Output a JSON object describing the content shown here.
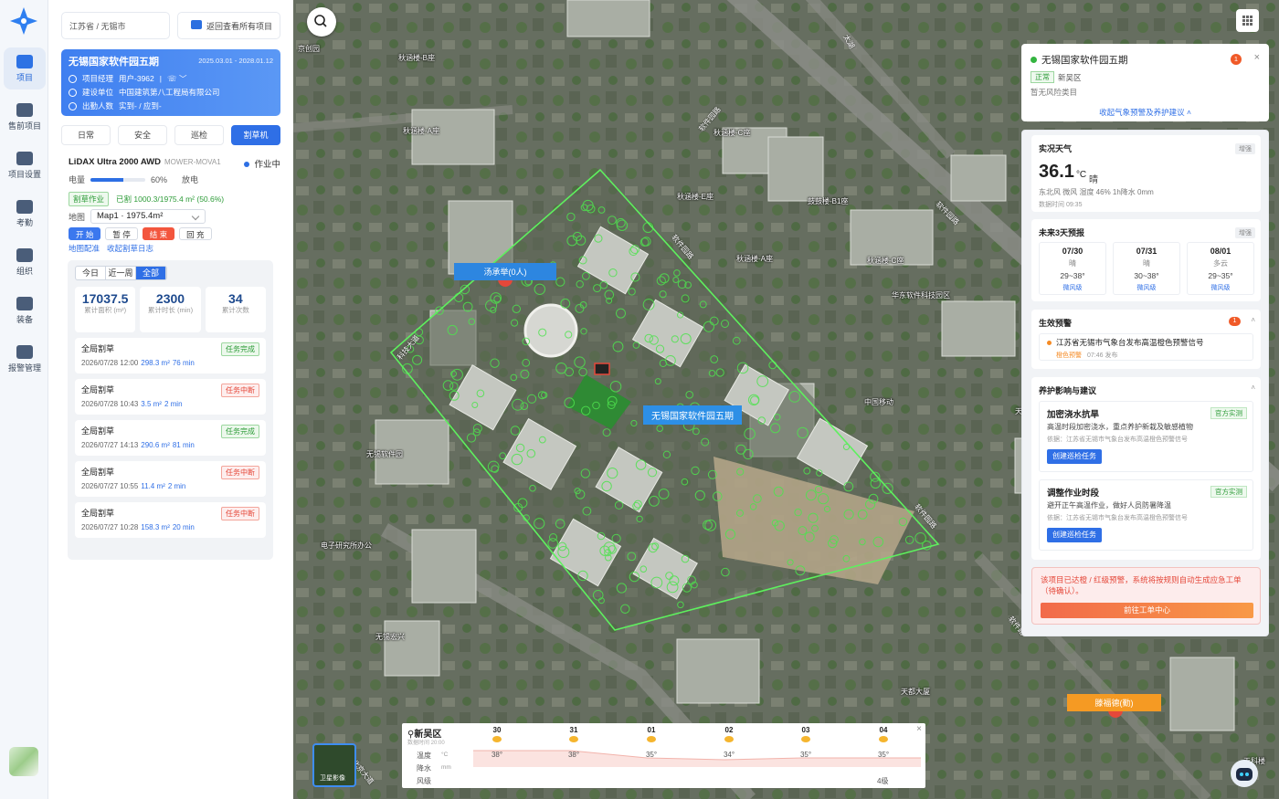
{
  "nav": {
    "items": [
      {
        "label": "项目"
      },
      {
        "label": "售前项目"
      },
      {
        "label": "项目设置"
      },
      {
        "label": "考勤"
      },
      {
        "label": "组织"
      },
      {
        "label": "装备"
      },
      {
        "label": "报警管理"
      }
    ]
  },
  "left": {
    "location": "江苏省 / 无锡市",
    "back_label": "返回查看所有项目",
    "project": {
      "name": "无锡国家软件园五期",
      "dates": "2025.03.01 - 2028.01.12",
      "manager_label": "项目经理",
      "manager": "用户-3962",
      "builder_label": "建设单位",
      "builder": "中国建筑第八工程局有限公司",
      "attend_label": "出勤人数",
      "attend": "实到- / 应到-"
    },
    "tabs": [
      "日常",
      "安全",
      "巡检",
      "割草机"
    ],
    "device": {
      "name": "LiDAX Ultra 2000 AWD",
      "model": "MOWER-MOVA1",
      "status": "作业中",
      "battery_label": "电量",
      "battery_pct": 60,
      "battery_text": "60%",
      "discharge": "放电",
      "mode_tag": "割草作业",
      "done": "已割 1000.3/1975.4 m² (50.6%)",
      "map_label": "地图",
      "map_value": "Map1 · 1975.4m²",
      "buttons": [
        "开 始",
        "暂 停",
        "结 束",
        "回 充"
      ],
      "links": [
        "地图配准",
        "收起割草日志"
      ]
    },
    "range": [
      "今日",
      "近一周",
      "全部"
    ],
    "totals": [
      {
        "value": "17037.5",
        "label": "累计面积 (m²)"
      },
      {
        "value": "2300",
        "label": "累计时长 (min)"
      },
      {
        "value": "34",
        "label": "累计次数"
      }
    ],
    "tasks": [
      {
        "name": "全局割草",
        "time": "2026/07/28 12:00",
        "area": "298.3 m²",
        "dur": "76 min",
        "status": "任务完成"
      },
      {
        "name": "全局割草",
        "time": "2026/07/28 10:43",
        "area": "3.5 m²",
        "dur": "2 min",
        "status": "任务中断"
      },
      {
        "name": "全局割草",
        "time": "2026/07/27 14:13",
        "area": "290.6 m²",
        "dur": "81 min",
        "status": "任务完成"
      },
      {
        "name": "全局割草",
        "time": "2026/07/27 10:55",
        "area": "11.4 m²",
        "dur": "2 min",
        "status": "任务中断"
      },
      {
        "name": "全局割草",
        "time": "2026/07/27 10:28",
        "area": "158.3 m²",
        "dur": "20 min",
        "status": "任务中断"
      }
    ]
  },
  "map": {
    "project_label": "无锡国家软件园五期",
    "person1": "汤承举(0人)",
    "person2": "滕福德(勤)",
    "layer_label": "卫星影像",
    "labels": [
      "京创园",
      "秋涵楼-B座",
      "秋涵楼-A座",
      "秋涵楼-C座",
      "秋涵楼-E座",
      "鼓鼓楼-B1座",
      "秋涵楼-A座",
      "秋涵楼-C座",
      "华东软件科技园区",
      "中国移动",
      "天都大厦",
      "无锡软件园",
      "无锡宏兴",
      "电子研究所办公",
      "无锡市公路桥梁",
      "天科楼",
      "软件及科技园",
      "天然商务中心"
    ],
    "roads": [
      "太湖",
      "软件园路",
      "软件园路",
      "软件园路",
      "软件园路",
      "软件园路",
      "科技大道",
      "天都路",
      "软件路",
      "北京大道"
    ]
  },
  "weather_strip": {
    "location": "新吴区",
    "updated": "数据时间 20:00",
    "rows": [
      "温度",
      "降水",
      "风级"
    ],
    "units": [
      "°C",
      "mm",
      ""
    ],
    "days": [
      {
        "d": "30",
        "t": "38°"
      },
      {
        "d": "31",
        "t": "38°"
      },
      {
        "d": "01",
        "t": "35°"
      },
      {
        "d": "02",
        "t": "34°"
      },
      {
        "d": "03",
        "t": "35°"
      },
      {
        "d": "04",
        "t": "35°"
      }
    ],
    "wind_last": "4级"
  },
  "right": {
    "project": "无锡国家软件园五期",
    "alert_count": "1",
    "status": "正常",
    "district": "新吴区",
    "risk": "暂无风险类目",
    "collapse": "收起气象预警及养护建议 ˄",
    "now": {
      "title": "实况天气",
      "tag": "增强",
      "temp": "36.1",
      "unit": "°C",
      "cond": "晴",
      "wind": "东北风 微风   湿度 46%   1h降水 0mm",
      "time": "数据时间 09:35"
    },
    "forecast": {
      "title": "未来3天预报",
      "tag": "增强",
      "days": [
        {
          "date": "07/30",
          "cond": "晴",
          "temp": "29~38°",
          "wind": "微风级"
        },
        {
          "date": "07/31",
          "cond": "晴",
          "temp": "30~38°",
          "wind": "微风级"
        },
        {
          "date": "08/01",
          "cond": "多云",
          "temp": "29~35°",
          "wind": "微风级"
        }
      ]
    },
    "warn": {
      "title": "生效预警",
      "count": "1",
      "text": "江苏省无锡市气象台发布高温橙色预警信号",
      "level": "橙色预警",
      "time": "07:46 发布"
    },
    "advice": {
      "title": "养护影响与建议",
      "items": [
        {
          "title": "加密浇水抗旱",
          "tag": "官方实测",
          "desc": "高温时段加密浇水，重点养护新栽及敏感植物",
          "basis": "依据：江苏省无锡市气象台发布高温橙色预警信号",
          "btn": "创建巡检任务"
        },
        {
          "title": "调整作业时段",
          "tag": "官方实测",
          "desc": "避开正午高温作业，做好人员防暑降温",
          "basis": "依据：江苏省无锡市气象台发布高温橙色预警信号",
          "btn": "创建巡检任务"
        }
      ]
    },
    "emergency": {
      "msg": "该项目已达橙 / 红级预警，系统将按规则自动生成应急工单（待确认）。",
      "btn": "前往工单中心"
    }
  },
  "colors": {
    "accent": "#2f6fe6",
    "site": "#5ef05e"
  }
}
